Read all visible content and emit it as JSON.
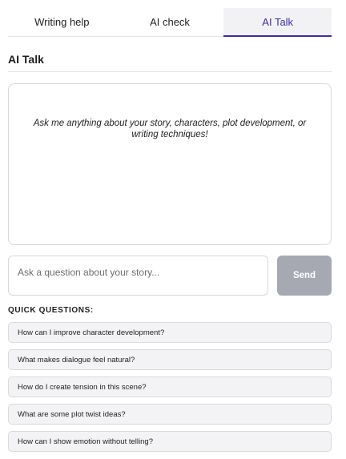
{
  "tabs": [
    {
      "label": "Writing help",
      "active": false
    },
    {
      "label": "AI check",
      "active": false
    },
    {
      "label": "AI Talk",
      "active": true
    }
  ],
  "section": {
    "title": "AI Talk"
  },
  "chat": {
    "placeholder": "Ask me anything about your story, characters, plot development, or writing techniques!"
  },
  "input": {
    "placeholder": "Ask a question about your story...",
    "value": ""
  },
  "send": {
    "label": "Send"
  },
  "quick_questions": {
    "heading": "QUICK QUESTIONS:",
    "items": [
      "How can I improve character development?",
      "What makes dialogue feel natural?",
      "How do I create tension in this scene?",
      "What are some plot twist ideas?",
      "How can I show emotion without telling?"
    ]
  },
  "colors": {
    "accent": "#3b2fa8",
    "send_disabled": "#a6a9b1",
    "quick_bg": "#f3f3f5",
    "border": "#d8d8dd"
  }
}
